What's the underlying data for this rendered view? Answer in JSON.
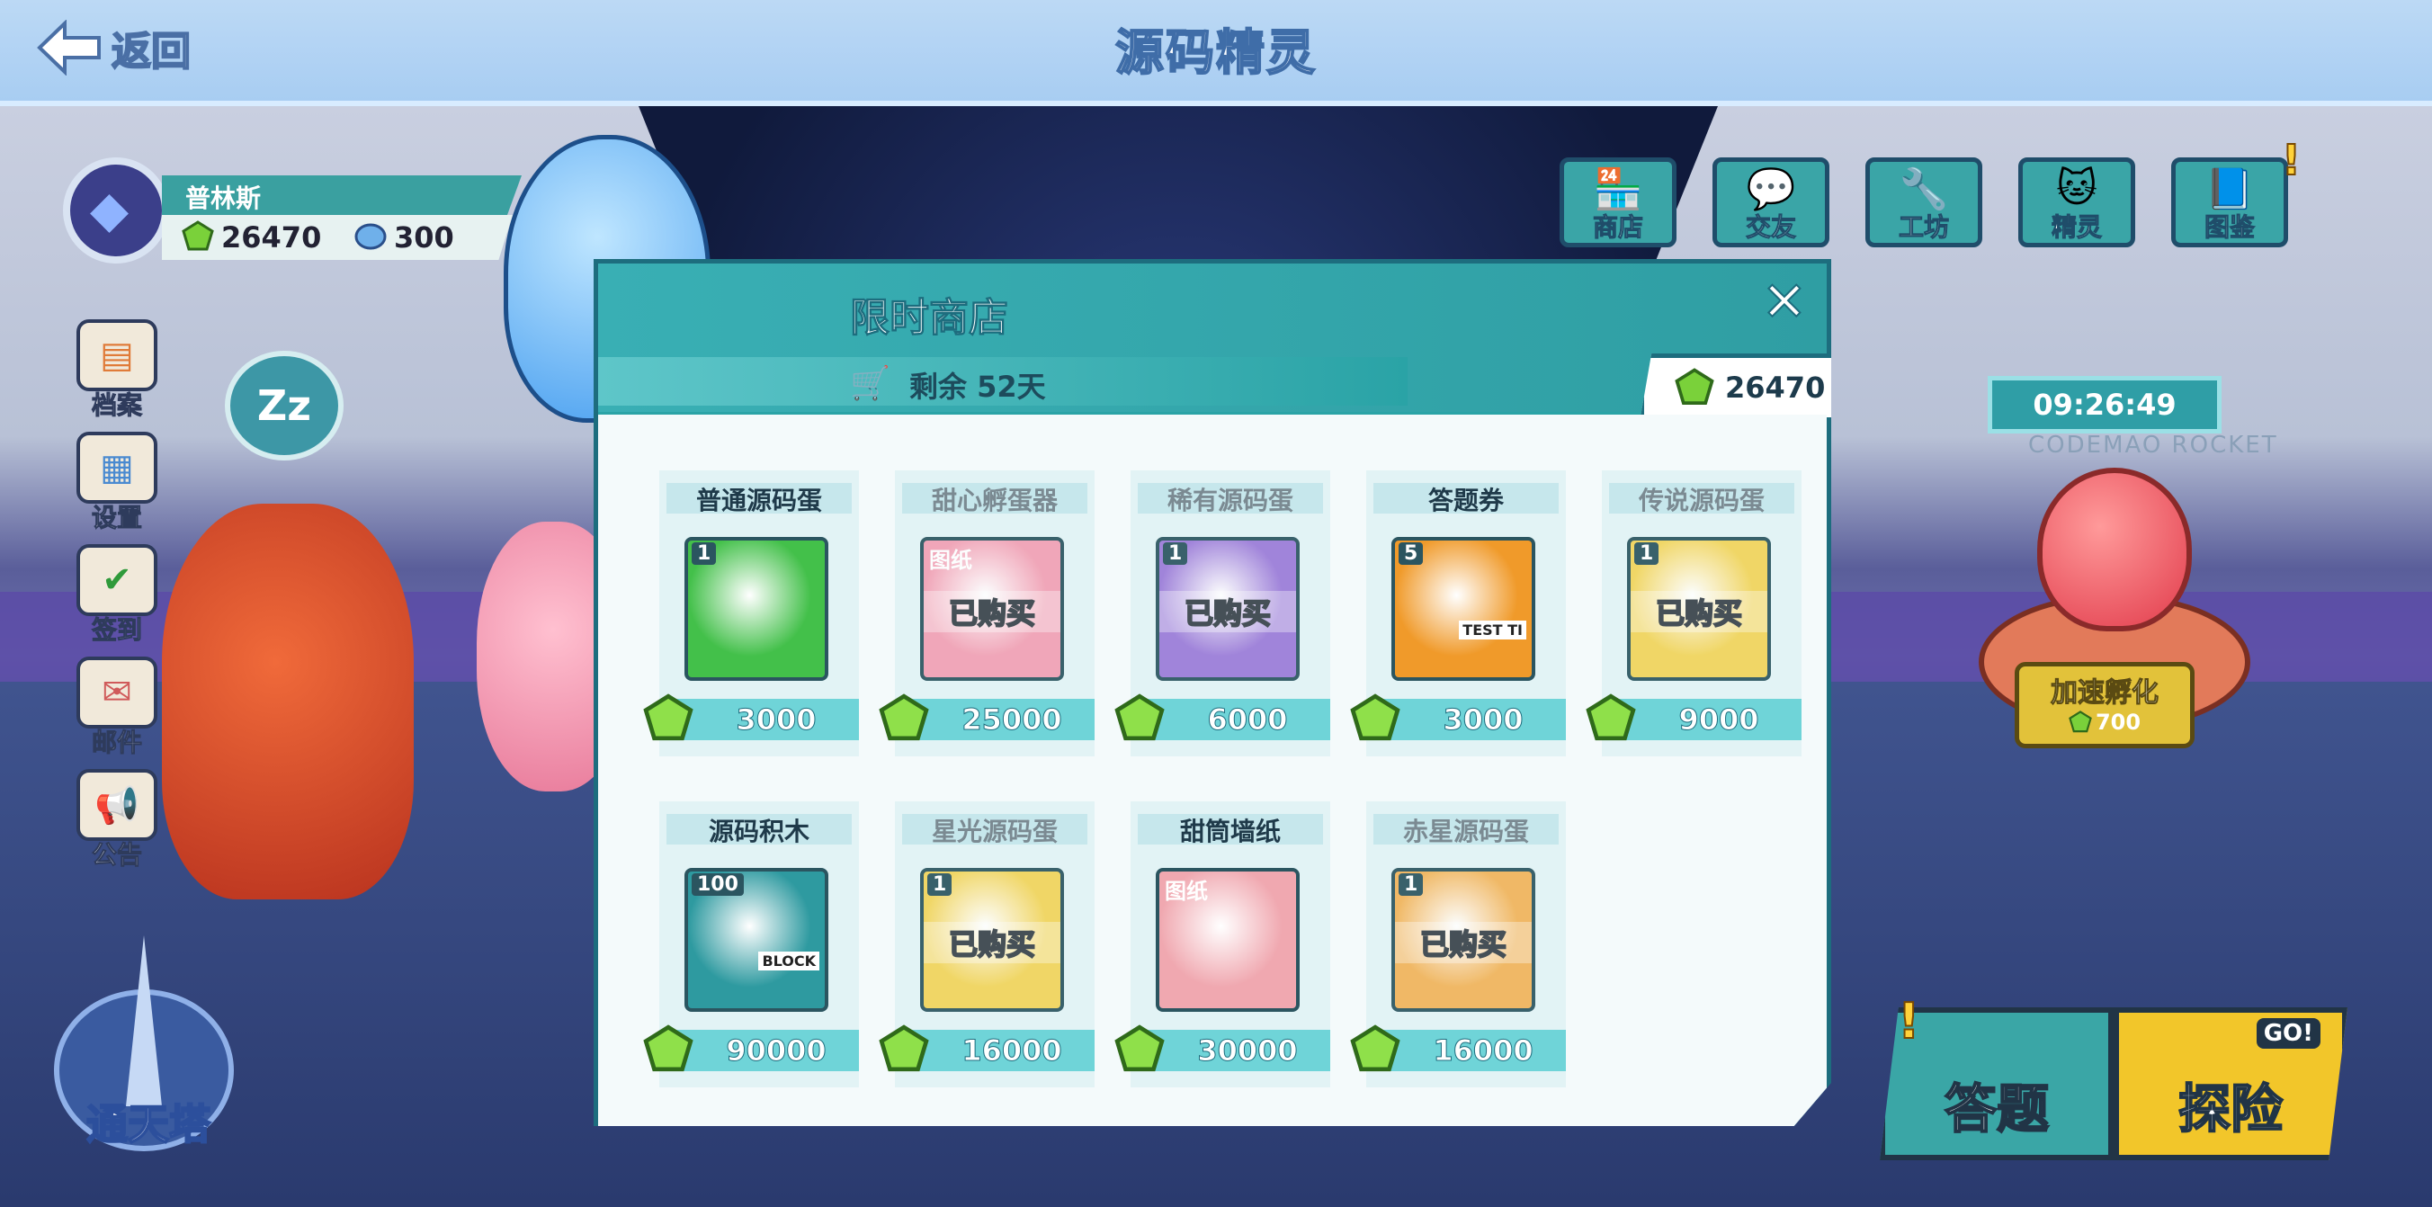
{
  "header": {
    "back_label": "返回",
    "title": "源码精灵"
  },
  "player": {
    "name": "普林斯",
    "gems": "26470",
    "crystals": "300"
  },
  "side_menu": [
    {
      "label": "档案",
      "icon": "folder-icon"
    },
    {
      "label": "设置",
      "icon": "settings-icon"
    },
    {
      "label": "签到",
      "icon": "calendar-check-icon"
    },
    {
      "label": "邮件",
      "icon": "mail-icon"
    },
    {
      "label": "公告",
      "icon": "megaphone-icon"
    }
  ],
  "top_menu": [
    {
      "label": "商店",
      "icon": "shop-icon"
    },
    {
      "label": "交友",
      "icon": "chat-bubble-icon"
    },
    {
      "label": "工坊",
      "icon": "tools-icon"
    },
    {
      "label": "精灵",
      "icon": "creature-icon"
    },
    {
      "label": "图鉴",
      "icon": "book-icon",
      "alert": "!"
    }
  ],
  "sleep_badge": "Zz",
  "incubator": {
    "timer": "09:26:49",
    "rocket_text": "CODEMAO ROCKET",
    "speed_label": "加速孵化",
    "speed_cost": "700"
  },
  "tower_label": "通天塔",
  "answer_button": {
    "label": "答题",
    "alert": "!"
  },
  "explore_button": {
    "label": "探险",
    "badge": "GO!"
  },
  "shop": {
    "title": "限时商店",
    "remaining": "剩余 52天",
    "balance": "26470",
    "items": [
      {
        "name": "普通源码蛋",
        "count": "1",
        "price": "3000",
        "purchased": false,
        "color": "#43c04a"
      },
      {
        "name": "甜心孵蛋器",
        "tag": "图纸",
        "price": "25000",
        "purchased": true,
        "stamp": "已购买",
        "color": "#f2a0b4"
      },
      {
        "name": "稀有源码蛋",
        "count": "1",
        "price": "6000",
        "purchased": true,
        "stamp": "已购买",
        "color": "#9b7bd8"
      },
      {
        "name": "答题券",
        "count": "5",
        "price": "3000",
        "purchased": false,
        "color": "#f09a2a",
        "card_text": "TEST TI"
      },
      {
        "name": "传说源码蛋",
        "count": "1",
        "price": "9000",
        "purchased": true,
        "stamp": "已购买",
        "color": "#f2d45a"
      },
      {
        "name": "源码积木",
        "count": "100",
        "price": "90000",
        "purchased": false,
        "color": "#2e9aa0",
        "card_text": "BLOCK"
      },
      {
        "name": "星光源码蛋",
        "count": "1",
        "price": "16000",
        "purchased": true,
        "stamp": "已购买",
        "color": "#f2d45a"
      },
      {
        "name": "甜筒墙纸",
        "tag": "图纸",
        "price": "30000",
        "purchased": false,
        "color": "#f0a8b0"
      },
      {
        "name": "赤星源码蛋",
        "count": "1",
        "price": "16000",
        "purchased": true,
        "stamp": "已购买",
        "color": "#f2b45a"
      }
    ]
  }
}
